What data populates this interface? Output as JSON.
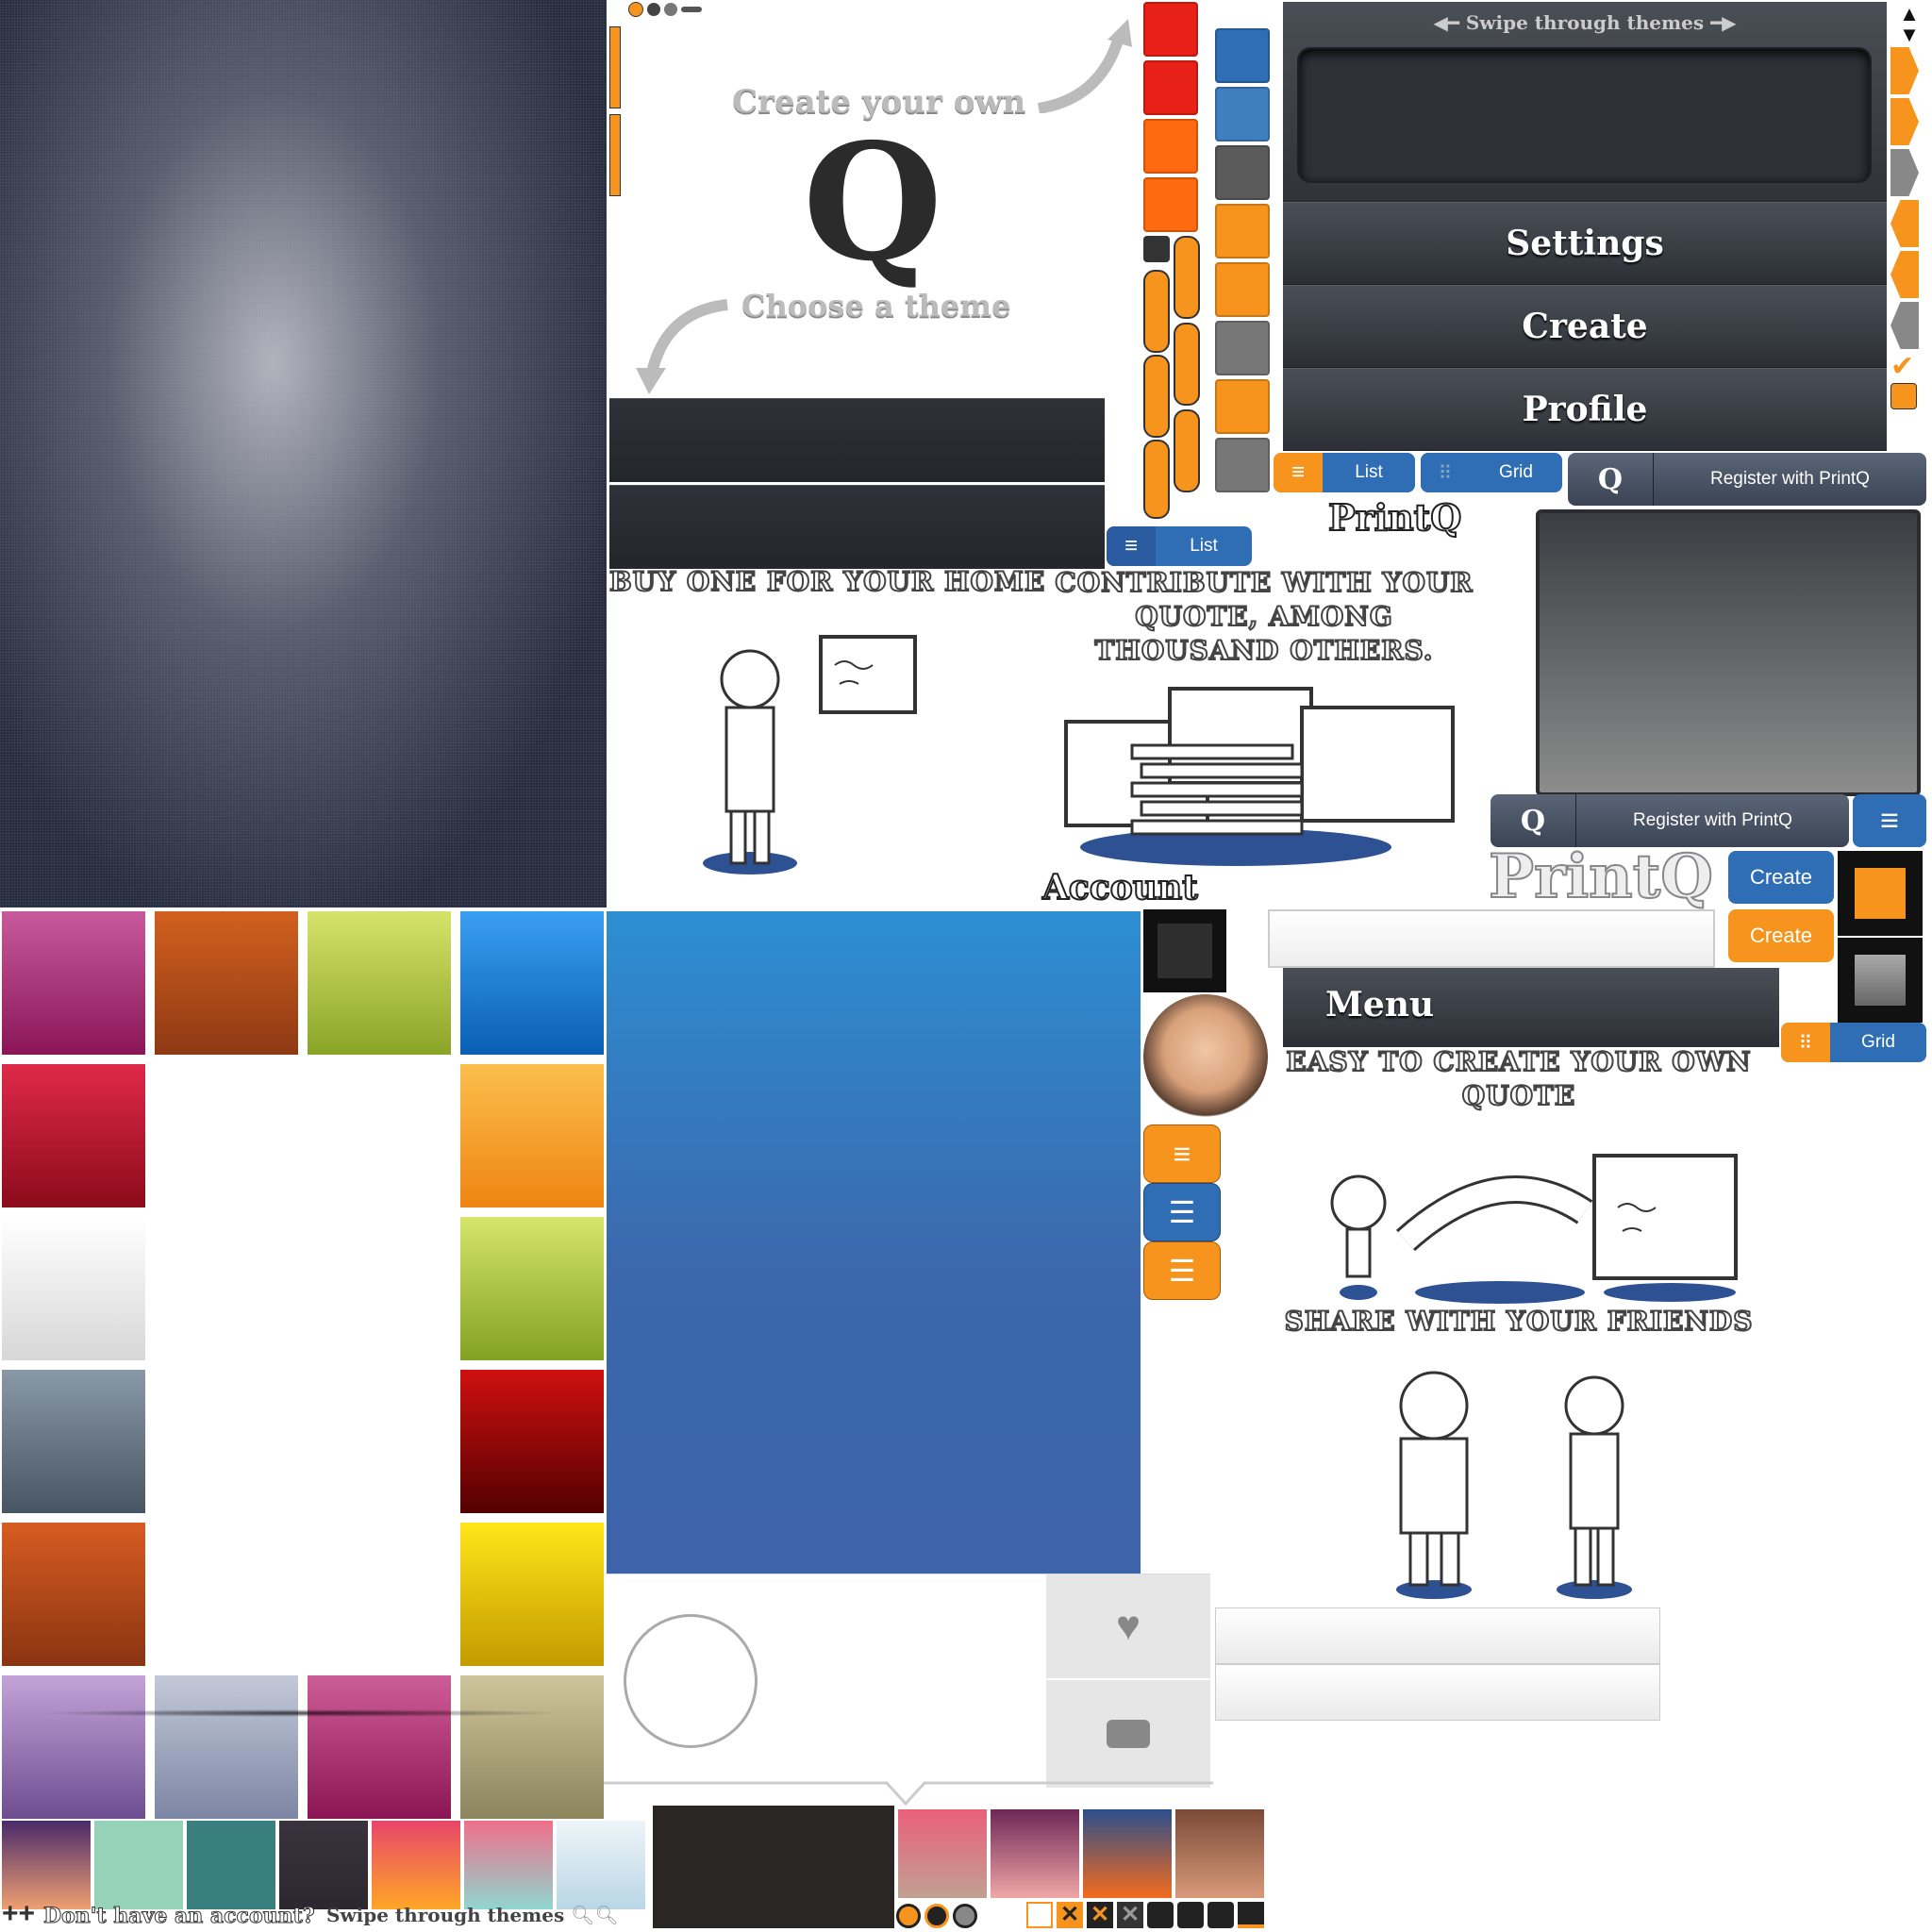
{
  "splash": {
    "create_your_own": "Create your own",
    "choose_a_theme": "Choose a theme",
    "logo_letter": "Q"
  },
  "theme_menu": {
    "swipe_label": "Swipe through themes",
    "items": [
      "Settings",
      "Create",
      "Profile"
    ]
  },
  "toggles": {
    "list_label": "List",
    "grid_label": "Grid",
    "register_label": "Register with PrintQ",
    "create_label": "Create"
  },
  "brand": {
    "name": "PrintQ"
  },
  "onboarding": {
    "buy_one": "BUY ONE FOR YOUR HOME",
    "contribute": "CONTRIBUTE WITH YOUR QUOTE, AMONG THOUSAND OTHERS.",
    "easy_create": "EASY TO CREATE YOUR OWN QUOTE",
    "share": "SHARE WITH YOUR FRIENDS"
  },
  "account": {
    "title": "Account",
    "menu_title": "Menu"
  },
  "footer": {
    "no_account": "Don't have an account?",
    "swipe": "Swipe through themes"
  },
  "colors": {
    "orange": "#f7941d",
    "blue": "#2f6db5",
    "dark": "#2b2f35"
  },
  "swatches": {
    "grid": [
      [
        "#c85a9c",
        "#8a1657"
      ],
      [
        "#d2601f",
        "#8e3914"
      ],
      [
        "#d6e36a",
        "#8aa428"
      ],
      [
        "#3a9ff0",
        "#0a5fb4"
      ],
      [
        "#e0294a",
        "#8b0b1b"
      ],
      [
        "#fbbf4d",
        "#ef8411"
      ],
      [
        "#ffffff",
        "#d7d7d7"
      ],
      [
        "#d6e46c",
        "#82a224"
      ],
      [
        "#8a99a8",
        "#485562"
      ],
      [
        "#cf1010",
        "#540000"
      ],
      [
        "#d85c22",
        "#8a3412"
      ],
      [
        "#ffe619",
        "#c39b00"
      ],
      [
        "#c4a3d8",
        "#6d4d90"
      ],
      [
        "#c3c9d8",
        "#7c86a4"
      ],
      [
        "#cd5d97",
        "#8c1655"
      ],
      [
        "#cfc59c",
        "#8b845c"
      ]
    ],
    "strip": [
      [
        "#4a2a6b",
        "#f0a070"
      ],
      [
        "#96d2b8",
        "#96d2b8"
      ],
      [
        "#3a7f80",
        "#3a7f80"
      ],
      [
        "#3a333d",
        "#2b2730"
      ],
      [
        "#e8456a",
        "#ffa726"
      ],
      [
        "#f06f8a",
        "#8fd6cf"
      ],
      [
        "#eef4f8",
        "#b9d6e6"
      ]
    ],
    "strip2": [
      [
        "#e9607a",
        "#c2a092"
      ],
      [
        "#6e2658",
        "#f0a7a6"
      ],
      [
        "#2a4f8c",
        "#f46b1d"
      ],
      [
        "#7a4a36",
        "#d99a7a"
      ]
    ]
  }
}
